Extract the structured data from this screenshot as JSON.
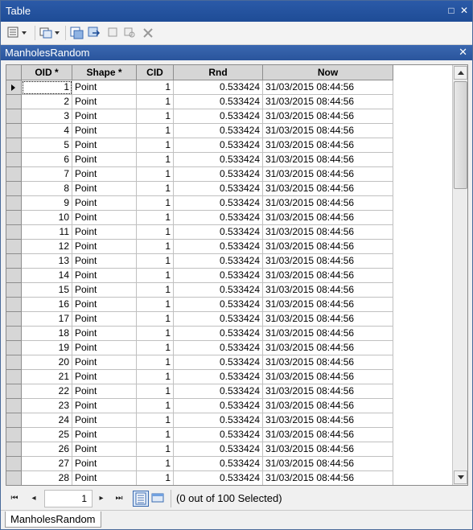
{
  "window": {
    "title": "Table",
    "pin_label": "□",
    "close_label": "✕"
  },
  "toolbar": {
    "icons": [
      "table-options-icon",
      "related-tables-icon",
      "select-by-attributes-icon",
      "switch-selection-icon",
      "clear-selection-icon",
      "zoom-to-selected-icon",
      "delete-selected-icon"
    ]
  },
  "table_tab": {
    "title": "ManholesRandom",
    "close_label": "✕"
  },
  "grid": {
    "columns": [
      "OID *",
      "Shape *",
      "CID",
      "Rnd",
      "Now"
    ],
    "rows": [
      [
        "1",
        "Point",
        "1",
        "0.533424",
        "31/03/2015 08:44:56"
      ],
      [
        "2",
        "Point",
        "1",
        "0.533424",
        "31/03/2015 08:44:56"
      ],
      [
        "3",
        "Point",
        "1",
        "0.533424",
        "31/03/2015 08:44:56"
      ],
      [
        "4",
        "Point",
        "1",
        "0.533424",
        "31/03/2015 08:44:56"
      ],
      [
        "5",
        "Point",
        "1",
        "0.533424",
        "31/03/2015 08:44:56"
      ],
      [
        "6",
        "Point",
        "1",
        "0.533424",
        "31/03/2015 08:44:56"
      ],
      [
        "7",
        "Point",
        "1",
        "0.533424",
        "31/03/2015 08:44:56"
      ],
      [
        "8",
        "Point",
        "1",
        "0.533424",
        "31/03/2015 08:44:56"
      ],
      [
        "9",
        "Point",
        "1",
        "0.533424",
        "31/03/2015 08:44:56"
      ],
      [
        "10",
        "Point",
        "1",
        "0.533424",
        "31/03/2015 08:44:56"
      ],
      [
        "11",
        "Point",
        "1",
        "0.533424",
        "31/03/2015 08:44:56"
      ],
      [
        "12",
        "Point",
        "1",
        "0.533424",
        "31/03/2015 08:44:56"
      ],
      [
        "13",
        "Point",
        "1",
        "0.533424",
        "31/03/2015 08:44:56"
      ],
      [
        "14",
        "Point",
        "1",
        "0.533424",
        "31/03/2015 08:44:56"
      ],
      [
        "15",
        "Point",
        "1",
        "0.533424",
        "31/03/2015 08:44:56"
      ],
      [
        "16",
        "Point",
        "1",
        "0.533424",
        "31/03/2015 08:44:56"
      ],
      [
        "17",
        "Point",
        "1",
        "0.533424",
        "31/03/2015 08:44:56"
      ],
      [
        "18",
        "Point",
        "1",
        "0.533424",
        "31/03/2015 08:44:56"
      ],
      [
        "19",
        "Point",
        "1",
        "0.533424",
        "31/03/2015 08:44:56"
      ],
      [
        "20",
        "Point",
        "1",
        "0.533424",
        "31/03/2015 08:44:56"
      ],
      [
        "21",
        "Point",
        "1",
        "0.533424",
        "31/03/2015 08:44:56"
      ],
      [
        "22",
        "Point",
        "1",
        "0.533424",
        "31/03/2015 08:44:56"
      ],
      [
        "23",
        "Point",
        "1",
        "0.533424",
        "31/03/2015 08:44:56"
      ],
      [
        "24",
        "Point",
        "1",
        "0.533424",
        "31/03/2015 08:44:56"
      ],
      [
        "25",
        "Point",
        "1",
        "0.533424",
        "31/03/2015 08:44:56"
      ],
      [
        "26",
        "Point",
        "1",
        "0.533424",
        "31/03/2015 08:44:56"
      ],
      [
        "27",
        "Point",
        "1",
        "0.533424",
        "31/03/2015 08:44:56"
      ],
      [
        "28",
        "Point",
        "1",
        "0.533424",
        "31/03/2015 08:44:56"
      ]
    ]
  },
  "navigation": {
    "first_label": "⏮",
    "prev_label": "◂",
    "current_record": "1",
    "next_label": "▸",
    "last_label": "⏭",
    "selection_status": "(0 out of 100 Selected)"
  },
  "bottom_tabs": [
    {
      "label": "ManholesRandom"
    }
  ]
}
